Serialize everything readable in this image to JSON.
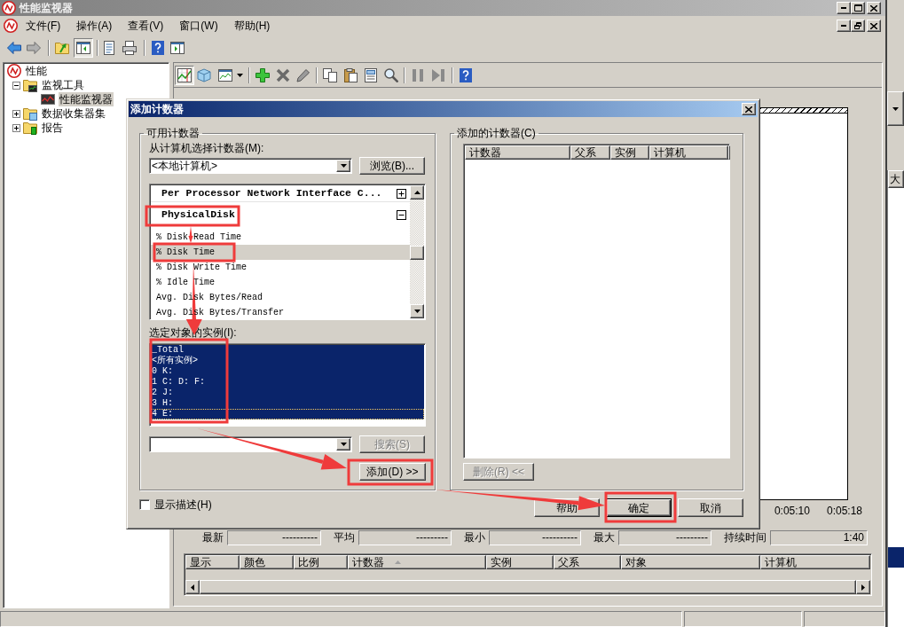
{
  "window": {
    "title": "性能监视器",
    "menu": [
      "文件(F)",
      "操作(A)",
      "查看(V)",
      "窗口(W)",
      "帮助(H)"
    ]
  },
  "tree": [
    {
      "label": "性能",
      "kind": "root",
      "selected": false,
      "children": [
        {
          "label": "监视工具",
          "kind": "tools",
          "expanded": true,
          "selected": false,
          "children": [
            {
              "label": "性能监视器",
              "kind": "monitor",
              "selected": true
            }
          ]
        },
        {
          "label": "数据收集器集",
          "kind": "collectors",
          "expanded": false,
          "selected": false
        },
        {
          "label": "报告",
          "kind": "reports",
          "expanded": false,
          "selected": false
        }
      ]
    }
  ],
  "monitor": {
    "time_labels": [
      "0:05:10",
      "0:05:18"
    ],
    "stats": [
      {
        "label": "最新",
        "value": "----------"
      },
      {
        "label": "平均",
        "value": "---------"
      },
      {
        "label": "最小",
        "value": "----------"
      },
      {
        "label": "最大",
        "value": "---------"
      },
      {
        "label": "持续时间",
        "value": "1:40"
      }
    ],
    "legend_columns": [
      {
        "label": "显示",
        "sorted": false
      },
      {
        "label": "颜色",
        "sorted": false
      },
      {
        "label": "比例",
        "sorted": false
      },
      {
        "label": "计数器",
        "sorted": true
      },
      {
        "label": "实例",
        "sorted": false
      },
      {
        "label": "父系",
        "sorted": false
      },
      {
        "label": "对象",
        "sorted": false
      },
      {
        "label": "计算机",
        "sorted": false
      }
    ]
  },
  "dialog": {
    "title": "添加计数器",
    "available": {
      "title": "可用计数器",
      "computer_label": "从计算机选择计数器(M):",
      "computer": "<本地计算机>",
      "browse_button": "浏览(B)...",
      "objects": [
        {
          "label": "Per Processor Network Interface C...",
          "expanded": false,
          "selected": false
        },
        {
          "label": "PhysicalDisk",
          "expanded": true,
          "selected": false,
          "children": [
            {
              "label": "% Disk Read Time",
              "selected": false
            },
            {
              "label": "% Disk Time",
              "selected": true
            },
            {
              "label": "% Disk Write Time",
              "selected": false
            },
            {
              "label": "% Idle Time",
              "selected": false
            },
            {
              "label": "Avg. Disk Bytes/Read",
              "selected": false
            },
            {
              "label": "Avg. Disk Bytes/Transfer",
              "selected": false
            }
          ]
        }
      ],
      "instances_label": "选定对象的实例(I):",
      "instances": [
        {
          "label": "_Total",
          "selected": true,
          "focused": false
        },
        {
          "label": "<所有实例>",
          "selected": true,
          "focused": false
        },
        {
          "label": "0 K:",
          "selected": true,
          "focused": false
        },
        {
          "label": "1 C: D: F:",
          "selected": true,
          "focused": false
        },
        {
          "label": "2 J:",
          "selected": true,
          "focused": false
        },
        {
          "label": "3 H:",
          "selected": true,
          "focused": false
        },
        {
          "label": "4 E:",
          "selected": true,
          "focused": true
        }
      ],
      "search_button": {
        "label": "搜索(S)",
        "disabled": true
      },
      "add_button": {
        "label": "添加(D) >>",
        "disabled": false
      }
    },
    "added": {
      "title": "添加的计数器(C)",
      "columns": [
        "计数器",
        "父系",
        "实例",
        "计算机"
      ],
      "remove_button": {
        "label": "删除(R) <<",
        "disabled": true
      }
    },
    "show_description": {
      "label": "显示描述(H)",
      "checked": false
    },
    "buttons": [
      {
        "label": "帮助",
        "default": false
      },
      {
        "label": "确定",
        "default": true
      },
      {
        "label": "取消",
        "default": false
      }
    ]
  },
  "background_window": {
    "column_label": "大"
  }
}
